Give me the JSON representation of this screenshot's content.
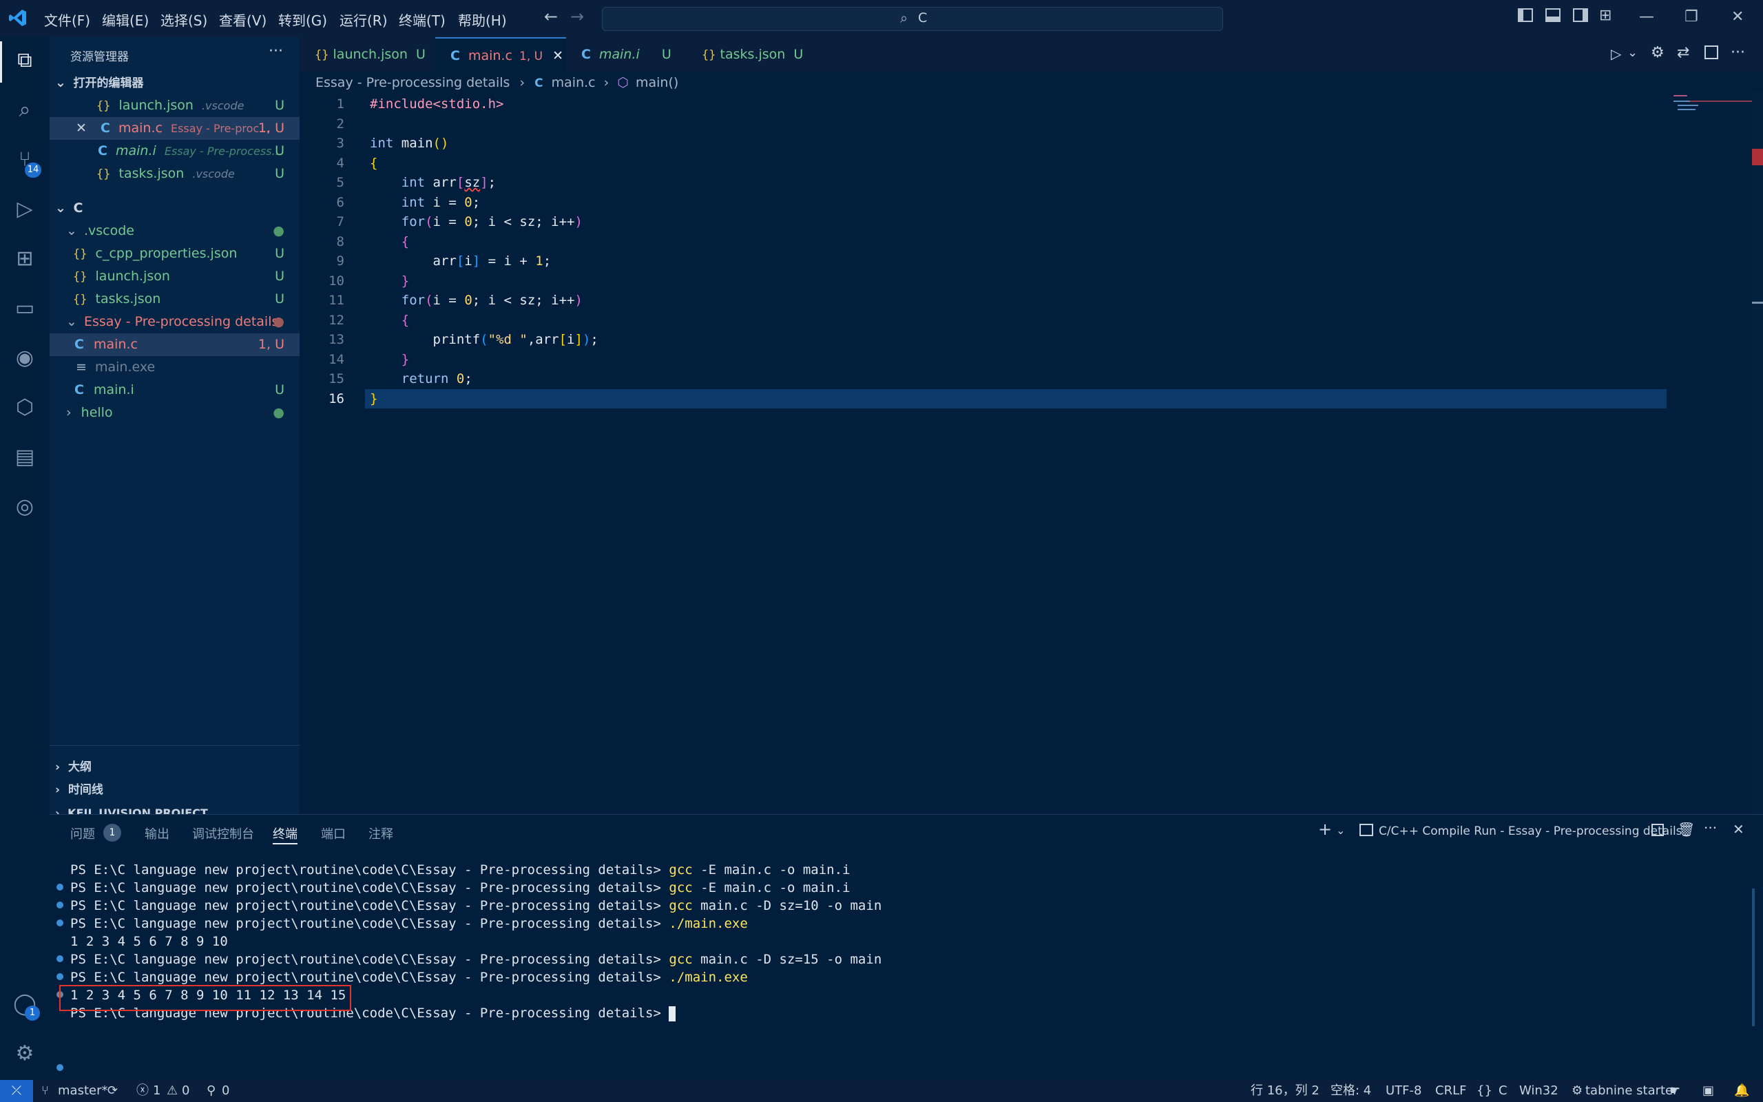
{
  "menu": [
    "文件(F)",
    "编辑(E)",
    "选择(S)",
    "查看(V)",
    "转到(G)",
    "运行(R)",
    "终端(T)",
    "帮助(H)"
  ],
  "command_center": "C",
  "activity_badges": {
    "scm": "14",
    "accounts": "1"
  },
  "sidebar": {
    "title": "资源管理器",
    "open_editors_title": "打开的编辑器",
    "open_editors": [
      {
        "name": "launch.json",
        "desc": ".vscode",
        "status": "U"
      },
      {
        "name": "main.c",
        "desc": "Essay - Pre-proc...",
        "status": "1, U"
      },
      {
        "name": "main.i",
        "desc": "Essay - Pre-process...",
        "status": "U"
      },
      {
        "name": "tasks.json",
        "desc": ".vscode",
        "status": "U"
      }
    ],
    "folder_title": "C",
    "tree": [
      {
        "name": ".vscode"
      },
      {
        "name": "c_cpp_properties.json",
        "status": "U"
      },
      {
        "name": "launch.json",
        "status": "U"
      },
      {
        "name": "tasks.json",
        "status": "U"
      },
      {
        "name": "Essay - Pre-processing details"
      },
      {
        "name": "main.c",
        "status": "1, U"
      },
      {
        "name": "main.exe"
      },
      {
        "name": "main.i",
        "status": "U"
      },
      {
        "name": "hello"
      }
    ],
    "outline": "大纲",
    "timeline": "时间线",
    "keil": "KEIL UVISION PROJECT"
  },
  "tabs": [
    {
      "name": "launch.json",
      "status": "U"
    },
    {
      "name": "main.c",
      "status": "1, U"
    },
    {
      "name": "main.i",
      "status": "U"
    },
    {
      "name": "tasks.json",
      "status": "U"
    }
  ],
  "breadcrumb": [
    "Essay - Pre-processing details",
    "main.c",
    "main()"
  ],
  "line_numbers": [
    "1",
    "2",
    "3",
    "4",
    "5",
    "6",
    "7",
    "8",
    "9",
    "10",
    "11",
    "12",
    "13",
    "14",
    "15",
    "16"
  ],
  "panel": {
    "tabs": [
      "问题",
      "输出",
      "调试控制台",
      "终端",
      "端口",
      "注释"
    ],
    "problems_count": "1",
    "terminal_name": "C/C++ Compile Run - Essay - Pre-processing details"
  },
  "terminal": [
    {
      "prompt": "PS E:\\C language new project\\routine\\code\\C\\Essay - Pre-processing details>",
      "cmd": "gcc",
      "args": " -E main.c -o main.i"
    },
    {
      "prompt": "PS E:\\C language new project\\routine\\code\\C\\Essay - Pre-processing details>",
      "cmd": "gcc",
      "args": " -E main.c -o main.i"
    },
    {
      "prompt": "PS E:\\C language new project\\routine\\code\\C\\Essay - Pre-processing details>",
      "cmd": "gcc",
      "args": " main.c -D sz=10 -o main"
    },
    {
      "prompt": "PS E:\\C language new project\\routine\\code\\C\\Essay - Pre-processing details>",
      "cmd": "./main.exe",
      "args": ""
    },
    {
      "prompt": "1 2 3 4 5 6 7 8 9 10",
      "cmd": "",
      "args": ""
    },
    {
      "prompt": "PS E:\\C language new project\\routine\\code\\C\\Essay - Pre-processing details>",
      "cmd": "gcc",
      "args": " main.c -D sz=15 -o main"
    },
    {
      "prompt": "PS E:\\C language new project\\routine\\code\\C\\Essay - Pre-processing details>",
      "cmd": "./main.exe",
      "args": ""
    },
    {
      "prompt": "1 2 3 4 5 6 7 8 9 10 11 12 13 14 15",
      "cmd": "",
      "args": ""
    },
    {
      "prompt": "PS E:\\C language new project\\routine\\code\\C\\Essay - Pre-processing details>",
      "cmd": "",
      "args": ""
    }
  ],
  "status": {
    "branch": "master*",
    "errors": "1",
    "warnings": "0",
    "ports": "0",
    "position": "行 16，列 2",
    "spaces": "空格: 4",
    "encoding": "UTF-8",
    "eol": "CRLF",
    "language": "C",
    "config": "Win32",
    "tabnine": "tabnine starter"
  }
}
